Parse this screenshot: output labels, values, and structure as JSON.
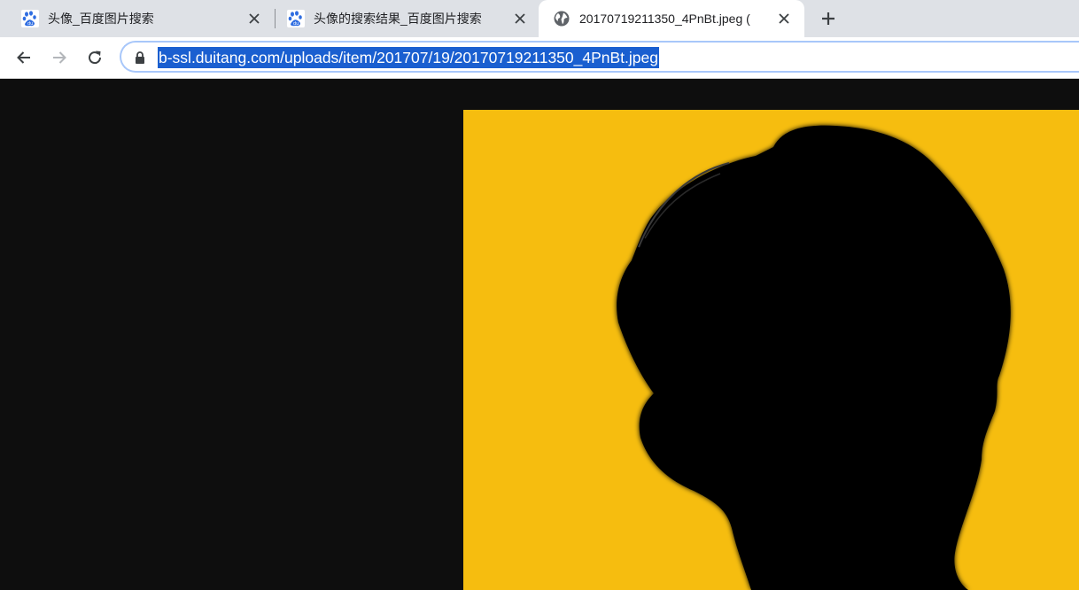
{
  "tabs": [
    {
      "title": "头像_百度图片搜索",
      "favicon": "baidu-paw-icon",
      "active": false
    },
    {
      "title": "头像的搜索结果_百度图片搜索",
      "favicon": "baidu-paw-icon",
      "active": false
    },
    {
      "title": "20170719211350_4PnBt.jpeg (",
      "favicon": "globe-icon",
      "active": true
    }
  ],
  "toolbar": {
    "back_icon": "back-arrow-icon",
    "forward_icon": "forward-arrow-icon",
    "reload_icon": "reload-icon",
    "new_tab_icon": "plus-icon"
  },
  "omnibox": {
    "url": "b-ssl.duitang.com/uploads/item/201707/19/20170719211350_4PnBt.jpeg",
    "selected": true,
    "lock_icon": "lock-icon"
  },
  "image": {
    "description_icon": "silhouette-portrait-image",
    "background_color": "#f6bd0f",
    "silhouette_color": "#000000"
  },
  "colors": {
    "tabstrip": "#dee1e6",
    "active_tab": "#ffffff",
    "selection": "#1a5fd0",
    "viewer_background": "#0e0e0e"
  }
}
